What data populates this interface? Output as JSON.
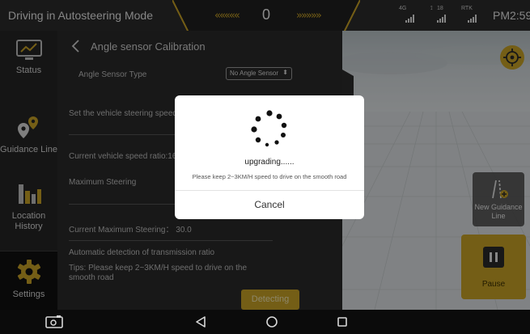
{
  "topbar": {
    "mode_title": "Driving in Autosteering Mode",
    "steer_left_arrows": "«««««",
    "steer_right_arrows": "»»»»»",
    "steer_value": "0",
    "signals": [
      {
        "label": "4G",
        "icon": "cellular-signal-icon"
      },
      {
        "label": "18",
        "icon": "satellite-signal-icon"
      },
      {
        "label": "RTK",
        "icon": "rtk-signal-icon"
      }
    ],
    "clock": "PM2:59"
  },
  "sidebar": {
    "items": [
      {
        "label": "Status",
        "icon": "monitor-chart-icon"
      },
      {
        "label": "Guidance Line",
        "icon": "route-pins-icon"
      },
      {
        "label": "Location History",
        "icon": "bar-chart-icon"
      },
      {
        "label": "Settings",
        "icon": "gear-icon"
      }
    ]
  },
  "panel": {
    "title": "Angle sensor Calibration",
    "sensor_type_label": "Angle Sensor Type",
    "sensor_type_value": "No Angle Sensor",
    "set_speed_label": "Set the vehicle steering speed",
    "speed_ratio_label": "Current vehicle speed ratio:16.",
    "max_steering_label": "Maximum Steering",
    "current_max_label": "Current Maximum Steering： 30.0",
    "auto_detect_label": "Automatic detection of transmission ratio",
    "tips_line1": "Tips: Please keep 2~3KM/H speed to drive on the",
    "tips_line2": "smooth road",
    "detect_button": "Detecting"
  },
  "view": {
    "new_guidance_label": "New Guidance Line",
    "pause_label": "Pause"
  },
  "dialog": {
    "title": "upgrading......",
    "message": "Please keep 2~3KM/H speed to drive on the smooth road",
    "cancel": "Cancel"
  },
  "colors": {
    "accent": "#c9a227",
    "topbar": "#2b2b2b",
    "panel": "#2a2a2a"
  }
}
